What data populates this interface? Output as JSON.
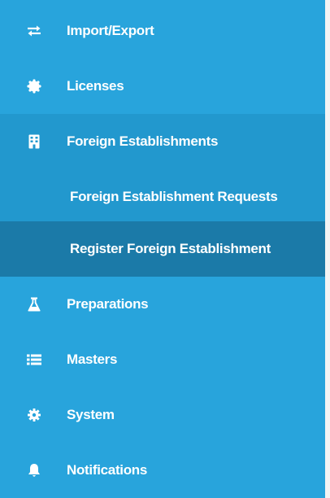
{
  "menu": {
    "items": [
      {
        "label": "Import/Export",
        "icon": "exchange-icon"
      },
      {
        "label": "Licenses",
        "icon": "certificate-icon"
      },
      {
        "label": "Foreign Establishments",
        "icon": "building-icon"
      },
      {
        "label": "Foreign Establishment Requests",
        "icon": ""
      },
      {
        "label": "Register Foreign Establishment",
        "icon": ""
      },
      {
        "label": "Preparations",
        "icon": "flask-icon"
      },
      {
        "label": "Masters",
        "icon": "list-icon"
      },
      {
        "label": "System",
        "icon": "gear-icon"
      },
      {
        "label": "Notifications",
        "icon": "bell-icon"
      }
    ]
  },
  "colors": {
    "sidebar_bg": "#28a4dc",
    "submenu_bg": "#2298ce",
    "active_bg": "#1b7aa8",
    "text": "#ffffff"
  }
}
